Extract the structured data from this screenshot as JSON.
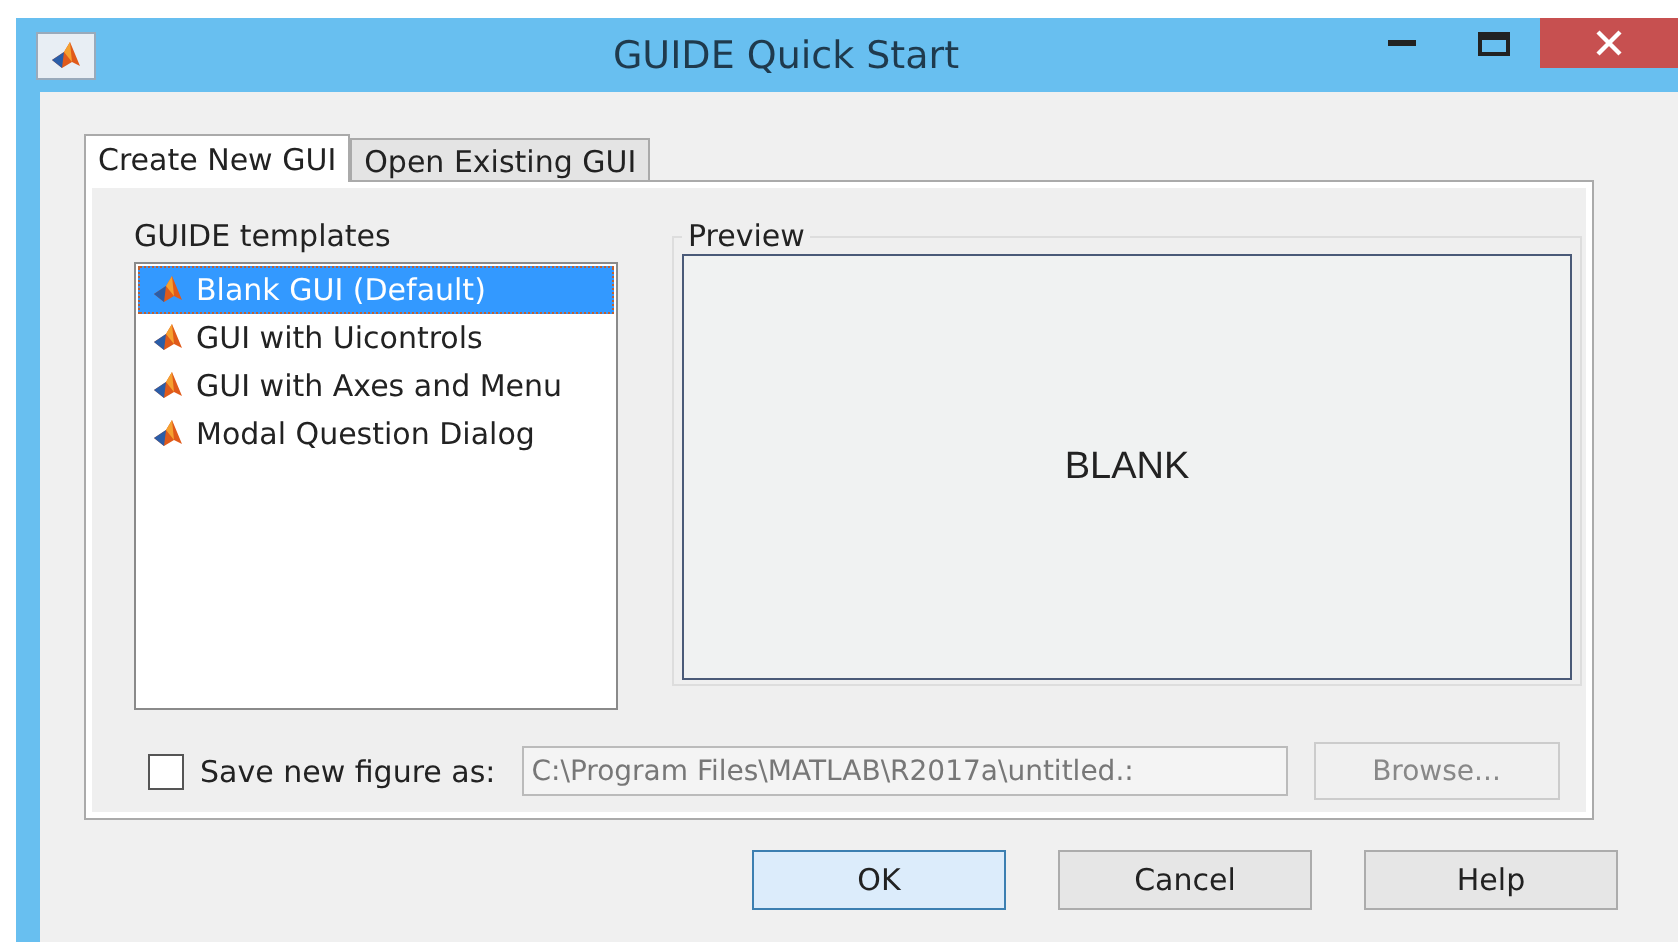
{
  "window": {
    "title": "GUIDE Quick Start"
  },
  "tabs": [
    {
      "label": "Create New GUI",
      "selected": true
    },
    {
      "label": "Open Existing GUI",
      "selected": false
    }
  ],
  "templates": {
    "label": "GUIDE templates",
    "items": [
      {
        "label": "Blank GUI (Default)",
        "selected": true
      },
      {
        "label": "GUI with Uicontrols",
        "selected": false
      },
      {
        "label": "GUI with Axes and Menu",
        "selected": false
      },
      {
        "label": "Modal Question Dialog",
        "selected": false
      }
    ]
  },
  "preview": {
    "label": "Preview",
    "text": "BLANK"
  },
  "save": {
    "label": "Save new figure as:",
    "checked": false,
    "value": "C:\\Program Files\\MATLAB\\R2017a\\untitled.:",
    "disabled": true
  },
  "browse": {
    "label": "Browse...",
    "disabled": true
  },
  "buttons": [
    {
      "label": "OK",
      "selected": true
    },
    {
      "label": "Cancel",
      "selected": false
    },
    {
      "label": "Help",
      "selected": false
    }
  ]
}
